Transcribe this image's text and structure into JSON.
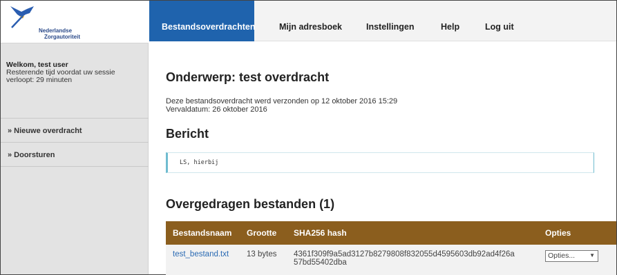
{
  "logo": {
    "line1": "Nederlandse",
    "line2": "Zorgautoriteit"
  },
  "user": {
    "welcome": "Welkom, test user",
    "session_line": "Resterende tijd voordat uw sessie verloopt: 29 minuten"
  },
  "sidebar": {
    "items": [
      {
        "label": "» Nieuwe overdracht"
      },
      {
        "label": "» Doorsturen"
      }
    ]
  },
  "nav": {
    "tabs": [
      {
        "label": "Bestandsoverdrachten",
        "active": true
      },
      {
        "label": "Mijn adresboek"
      },
      {
        "label": "Instellingen"
      },
      {
        "label": "Help"
      },
      {
        "label": "Log uit"
      }
    ]
  },
  "transfer": {
    "subject": "Onderwerp: test overdracht",
    "sent_line": "Deze bestandsoverdracht werd verzonden op 12 oktober 2016 15:29",
    "expiry_line": "Vervaldatum: 26 oktober 2016",
    "message_heading": "Bericht",
    "message": "LS, hierbij",
    "files_heading": "Overgedragen bestanden (1)"
  },
  "files_table": {
    "columns": [
      "Bestandsnaam",
      "Grootte",
      "SHA256 hash",
      "Opties"
    ],
    "rows": [
      {
        "name": "test_bestand.txt",
        "size": "13 bytes",
        "hash_line1": "4361f309f9a5ad3127b8279808f832055d4595603db92ad4f26a",
        "hash_line2": "57bd55402dba",
        "option": "Opties..."
      }
    ]
  },
  "colors": {
    "nav_active": "#1f63ad",
    "table_header": "#8b5e1e",
    "link": "#2a6ab3",
    "sidebar_bg": "#e3e3e3"
  }
}
